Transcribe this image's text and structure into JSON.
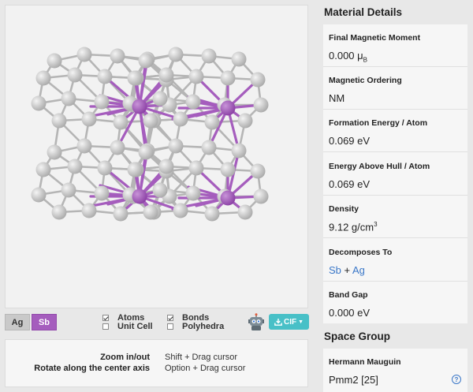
{
  "elements": [
    "Ag",
    "Sb"
  ],
  "colors": {
    "ag": "#c9c9c9",
    "sb": "#a55dbd",
    "cif": "#48c0c7",
    "link": "#3a77c8"
  },
  "toggles": {
    "atoms": {
      "label": "Atoms",
      "checked": true
    },
    "unit_cell": {
      "label": "Unit Cell",
      "checked": false
    },
    "bonds": {
      "label": "Bonds",
      "checked": true
    },
    "polyhedra": {
      "label": "Polyhedra",
      "checked": false
    }
  },
  "download": {
    "label": "CIF",
    "icon": "download-icon"
  },
  "help": [
    {
      "action": "Zoom in/out",
      "gesture": "Shift + Drag cursor"
    },
    {
      "action": "Rotate along the center axis",
      "gesture": "Option + Drag cursor"
    }
  ],
  "details": {
    "title": "Material Details",
    "magnetic_moment": {
      "label": "Final Magnetic Moment",
      "value": "0.000 μ",
      "sub": "B"
    },
    "magnetic_ordering": {
      "label": "Magnetic Ordering",
      "value": "NM"
    },
    "formation_energy": {
      "label": "Formation Energy / Atom",
      "value": "0.069 eV"
    },
    "energy_above_hull": {
      "label": "Energy Above Hull / Atom",
      "value": "0.069 eV"
    },
    "density": {
      "label": "Density",
      "value": "9.12 g/cm",
      "sup": "3"
    },
    "decomposes_to": {
      "label": "Decomposes To",
      "a": "Sb",
      "plus": " + ",
      "b": "Ag"
    },
    "band_gap": {
      "label": "Band Gap",
      "value": "0.000 eV"
    }
  },
  "space_group": {
    "title": "Space Group",
    "hermann_mauguin": {
      "label": "Hermann Mauguin",
      "value": "Pmm2 [25]"
    }
  }
}
